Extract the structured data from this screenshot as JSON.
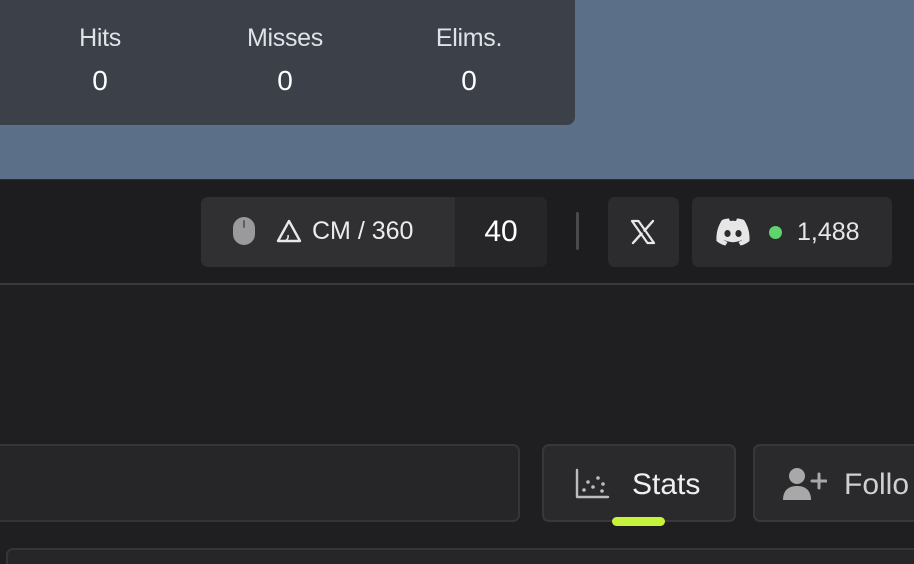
{
  "stats": [
    {
      "label": "Hits",
      "value": "0"
    },
    {
      "label": "Misses",
      "value": "0"
    },
    {
      "label": "Elims.",
      "value": "0"
    }
  ],
  "sensitivity": {
    "icons": [
      "mouse-icon",
      "triangle-icon"
    ],
    "unit": "CM / 360",
    "value": "40"
  },
  "social": {
    "x_icon": "x-logo-icon",
    "discord_icon": "discord-icon",
    "discord_online": "1,488",
    "online_color": "#5fd36d"
  },
  "tabs": [
    {
      "label": "Stats",
      "icon": "scatter-chart-icon",
      "active": true
    },
    {
      "label": "Follo",
      "icon": "add-user-icon",
      "active": false
    }
  ],
  "colors": {
    "accent": "#c6f23a",
    "hero": "#5b6f88"
  }
}
